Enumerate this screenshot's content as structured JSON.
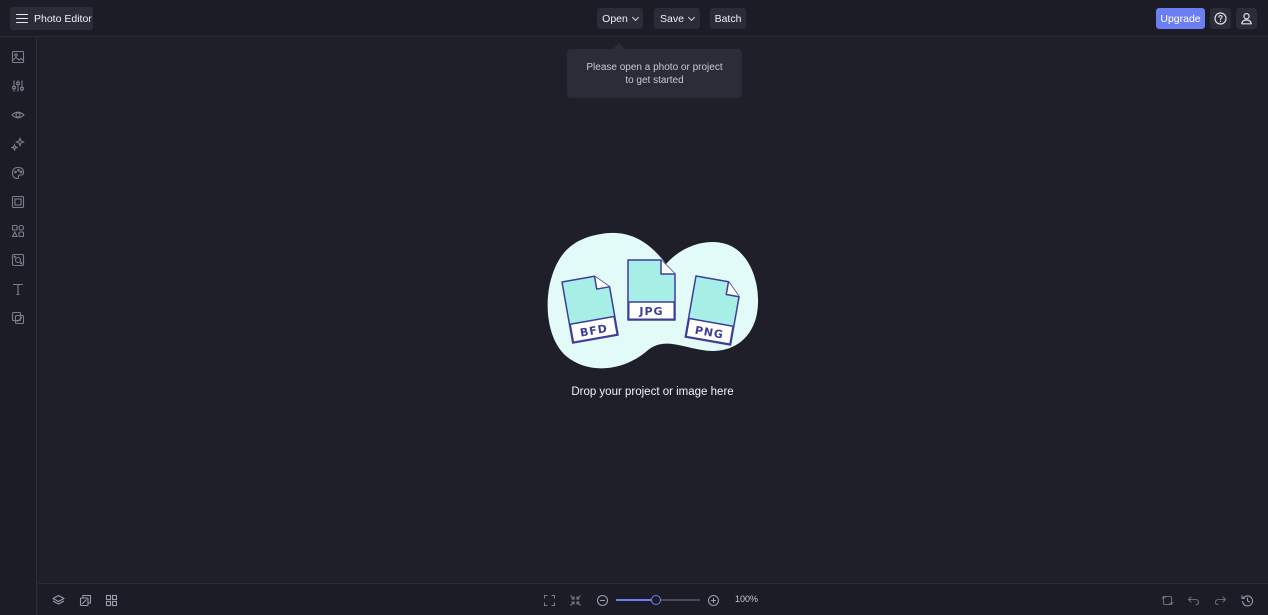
{
  "header": {
    "app_title": "Photo Editor",
    "open_label": "Open",
    "save_label": "Save",
    "batch_label": "Batch",
    "upgrade_label": "Upgrade"
  },
  "tooltip": {
    "text": "Please open a photo or project to get started"
  },
  "drop_zone": {
    "formats": [
      "BFD",
      "JPG",
      "PNG"
    ],
    "text": "Drop your project or image here"
  },
  "sidebar": {
    "items": [
      {
        "icon": "image-icon"
      },
      {
        "icon": "adjustments-icon"
      },
      {
        "icon": "eye-icon"
      },
      {
        "icon": "sparkles-icon"
      },
      {
        "icon": "paint-palette-icon"
      },
      {
        "icon": "frame-icon"
      },
      {
        "icon": "shapes-icon"
      },
      {
        "icon": "texture-icon"
      },
      {
        "icon": "text-icon"
      },
      {
        "icon": "graphics-icon"
      }
    ]
  },
  "footer": {
    "zoom_label": "100%",
    "zoom_level": 0.48
  },
  "colors": {
    "accent": "#6c7ff2",
    "background": "#1f1f29",
    "panel": "#1b1c25",
    "button": "#2b2c38",
    "blob": "#e3fbf8",
    "file_fill": "#a7efe6",
    "file_stroke": "#3d3d9a"
  }
}
